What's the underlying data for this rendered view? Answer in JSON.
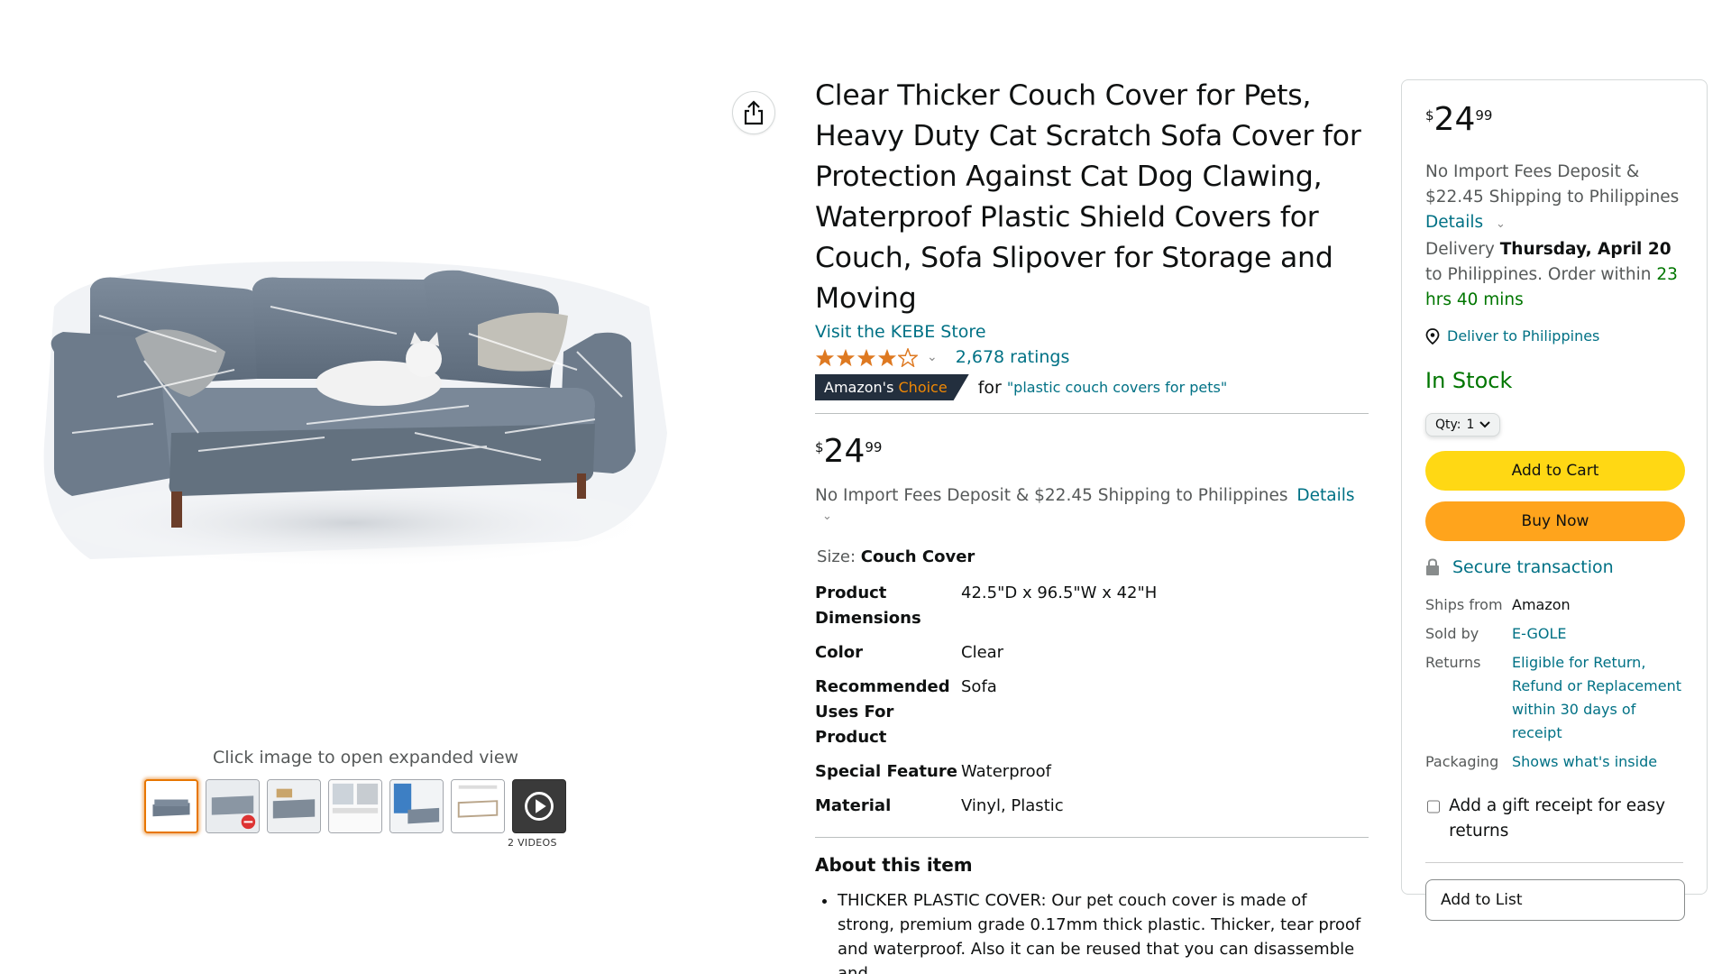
{
  "gallery": {
    "click_hint": "Click image to open expanded view",
    "videos_label": "2 VIDEOS"
  },
  "product": {
    "title": "Clear Thicker Couch Cover for Pets, Heavy Duty Cat Scratch Sofa Cover for Protection Against Cat Dog Clawing, Waterproof Plastic Shield Covers for Couch, Sofa Slipover for Storage and Moving",
    "store_link": "Visit the KEBE Store",
    "rating_stars": 4.5,
    "ratings_count": "2,678 ratings",
    "badge_prefix": "Amazon's",
    "badge_suffix": "Choice",
    "badge_for": "for",
    "badge_query": "\"plastic couch covers for pets\"",
    "price": {
      "symbol": "$",
      "whole": "24",
      "fraction": "99"
    },
    "shipping_text": "No Import Fees Deposit & $22.45 Shipping to Philippines",
    "details_link": "Details",
    "size_label": "Size:",
    "size_value": "Couch Cover",
    "specs": [
      {
        "key": "Product Dimensions",
        "value": "42.5\"D x 96.5\"W x 42\"H"
      },
      {
        "key": "Color",
        "value": "Clear"
      },
      {
        "key": "Recommended Uses For Product",
        "value": "Sofa"
      },
      {
        "key": "Special Feature",
        "value": "Waterproof"
      },
      {
        "key": "Material",
        "value": "Vinyl, Plastic"
      }
    ],
    "about_heading": "About this item",
    "about_items": [
      "THICKER PLASTIC COVER: Our pet couch cover is made of strong, premium grade 0.17mm thick plastic. Thicker, tear proof and waterproof. Also it can be reused that you can disassemble and"
    ]
  },
  "buybox": {
    "price": {
      "symbol": "$",
      "whole": "24",
      "fraction": "99"
    },
    "shipping_text": "No Import Fees Deposit & $22.45 Shipping to Philippines",
    "details_link": "Details",
    "delivery_prefix": "Delivery",
    "delivery_date": "Thursday, April 20",
    "delivery_mid": "to Philippines. Order within",
    "delivery_countdown": "23 hrs 40 mins",
    "deliver_to": "Deliver to Philippines",
    "stock": "In Stock",
    "qty_label": "Qty:",
    "qty_value": "1",
    "add_to_cart": "Add to Cart",
    "buy_now": "Buy Now",
    "secure": "Secure transaction",
    "info": [
      {
        "key": "Ships from",
        "value": "Amazon",
        "link": false
      },
      {
        "key": "Sold by",
        "value": "E-GOLE",
        "link": true
      },
      {
        "key": "Returns",
        "value": "Eligible for Return, Refund or Replacement within 30 days of receipt",
        "link": true
      },
      {
        "key": "Packaging",
        "value": "Shows what's inside",
        "link": true
      }
    ],
    "gift_receipt": "Add a gift receipt for easy returns",
    "add_to_list": "Add to List"
  },
  "colors": {
    "link": "#007185",
    "add_to_cart": "#FFD814",
    "buy_now": "#FFA41C",
    "in_stock": "#007600",
    "star": "#DE7921",
    "badge_bg": "#232F3E",
    "badge_accent": "#F08804"
  }
}
